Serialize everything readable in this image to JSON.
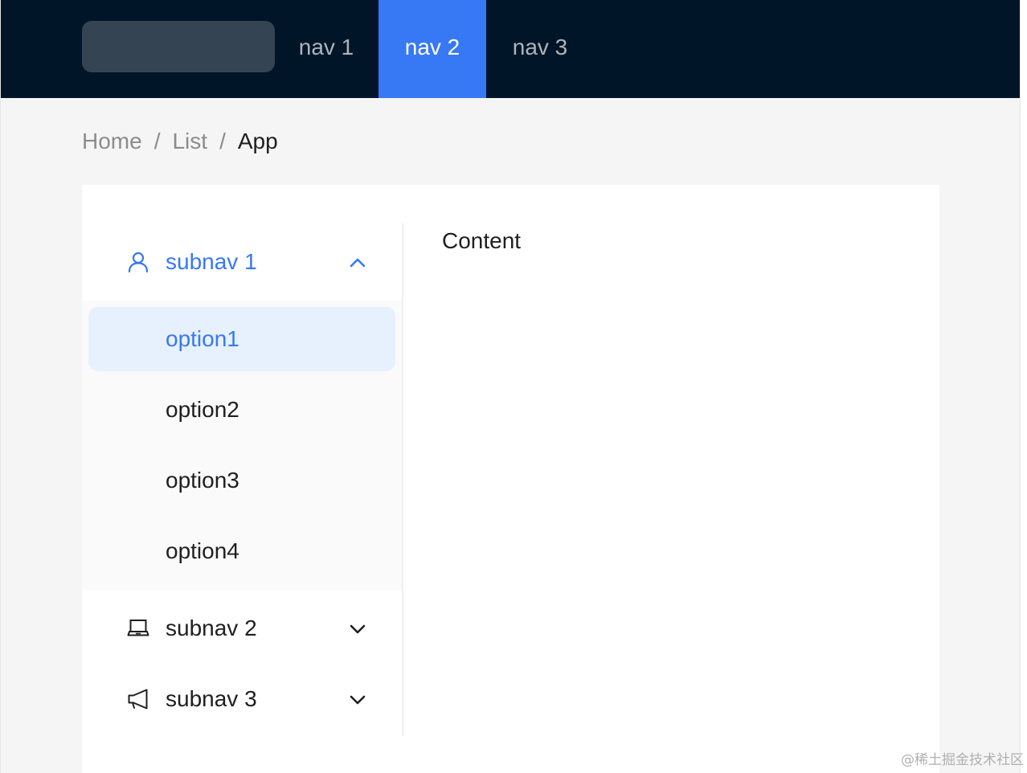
{
  "header": {
    "nav": [
      {
        "label": "nav 1",
        "active": false
      },
      {
        "label": "nav 2",
        "active": true
      },
      {
        "label": "nav 3",
        "active": false
      }
    ]
  },
  "breadcrumb": {
    "items": [
      "Home",
      "List",
      "App"
    ],
    "separator": "/"
  },
  "sider": {
    "submenus": [
      {
        "label": "subnav 1",
        "icon": "user-icon",
        "expanded": true,
        "options": [
          "option1",
          "option2",
          "option3",
          "option4"
        ],
        "selected": "option1"
      },
      {
        "label": "subnav 2",
        "icon": "laptop-icon",
        "expanded": false
      },
      {
        "label": "subnav 3",
        "icon": "notification-icon",
        "expanded": false
      }
    ]
  },
  "content": {
    "text": "Content"
  },
  "watermark": "@稀土掘金技术社区",
  "colors": {
    "header_bg": "#011528",
    "accent": "#3778f5",
    "selected_bg": "#e7f1fe",
    "page_bg": "#f5f5f5",
    "logo_placeholder": "#354452"
  }
}
